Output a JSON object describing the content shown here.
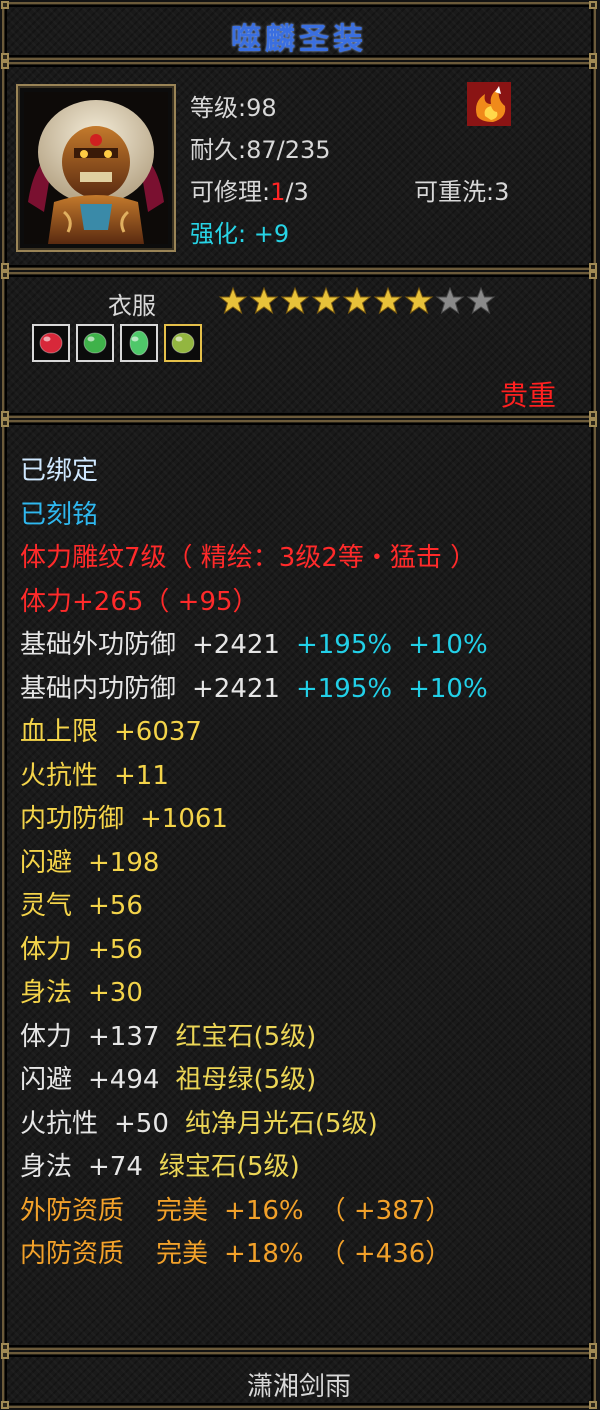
{
  "title": "噬麟圣装",
  "info": {
    "level": "等级:98",
    "durability": "耐久:87/235",
    "repair_prefix": "可修理:",
    "repair_used": "1",
    "repair_suffix": "/3",
    "rewash": "可重洗:3",
    "enhance_label": "强化:",
    "enhance_value": "+9"
  },
  "item_type": "衣服",
  "stars": {
    "filled": 7,
    "total": 9
  },
  "gems": [
    {
      "icon": "ruby-gem-icon",
      "color": "#d8283a"
    },
    {
      "icon": "emerald-gem-icon",
      "color": "#3fb24a"
    },
    {
      "icon": "green-crystal-gem-icon",
      "color": "#4fc86a"
    },
    {
      "icon": "jade-gem-icon",
      "color": "#93b640"
    }
  ],
  "rarity": "贵重",
  "attributes": {
    "bound": "已绑定",
    "engraved": "已刻铭",
    "carving": "体力雕纹7级（ 精绘：3级2等・猛击 ）",
    "stamina_bonus": "体力+265（ +95）",
    "ext_def": {
      "label": "基础外功防御",
      "value": "+2421",
      "pct1": "+195%",
      "pct2": "+10%"
    },
    "int_def": {
      "label": "基础内功防御",
      "value": "+2421",
      "pct1": "+195%",
      "pct2": "+10%"
    },
    "hp_max": {
      "label": "血上限",
      "value": "+6037"
    },
    "fire_res": {
      "label": "火抗性",
      "value": "+11"
    },
    "inner_def": {
      "label": "内功防御",
      "value": "+1061"
    },
    "dodge": {
      "label": "闪避",
      "value": "+198"
    },
    "spirit": {
      "label": "灵气",
      "value": "+56"
    },
    "stamina": {
      "label": "体力",
      "value": "+56"
    },
    "agility": {
      "label": "身法",
      "value": "+30"
    },
    "gem_lines": [
      {
        "label": "体力",
        "value": "+137",
        "gem": "红宝石",
        "lvl": "(5级)"
      },
      {
        "label": "闪避",
        "value": "+494",
        "gem": "祖母绿",
        "lvl": "(5级)"
      },
      {
        "label": "火抗性",
        "value": "+50",
        "gem": "纯净月光石",
        "lvl": "(5级)"
      },
      {
        "label": "身法",
        "value": "+74",
        "gem": "绿宝石",
        "lvl": "(5级)"
      }
    ],
    "quality_lines": [
      {
        "label": "外防资质",
        "grade": "完美",
        "pct": "+16%",
        "extra": "（ +387）"
      },
      {
        "label": "内防资质",
        "grade": "完美",
        "pct": "+18%",
        "extra": "（ +436）"
      }
    ]
  },
  "footer": "潇湘剑雨",
  "colors": {
    "title": "#3a6fe0",
    "red": "#ff2a2a",
    "cyan": "#22d0e8",
    "yellow": "#f4d44a",
    "orange": "#f2a12a",
    "star_gold": "#e8c23a",
    "star_grey": "#8a8a8a"
  }
}
